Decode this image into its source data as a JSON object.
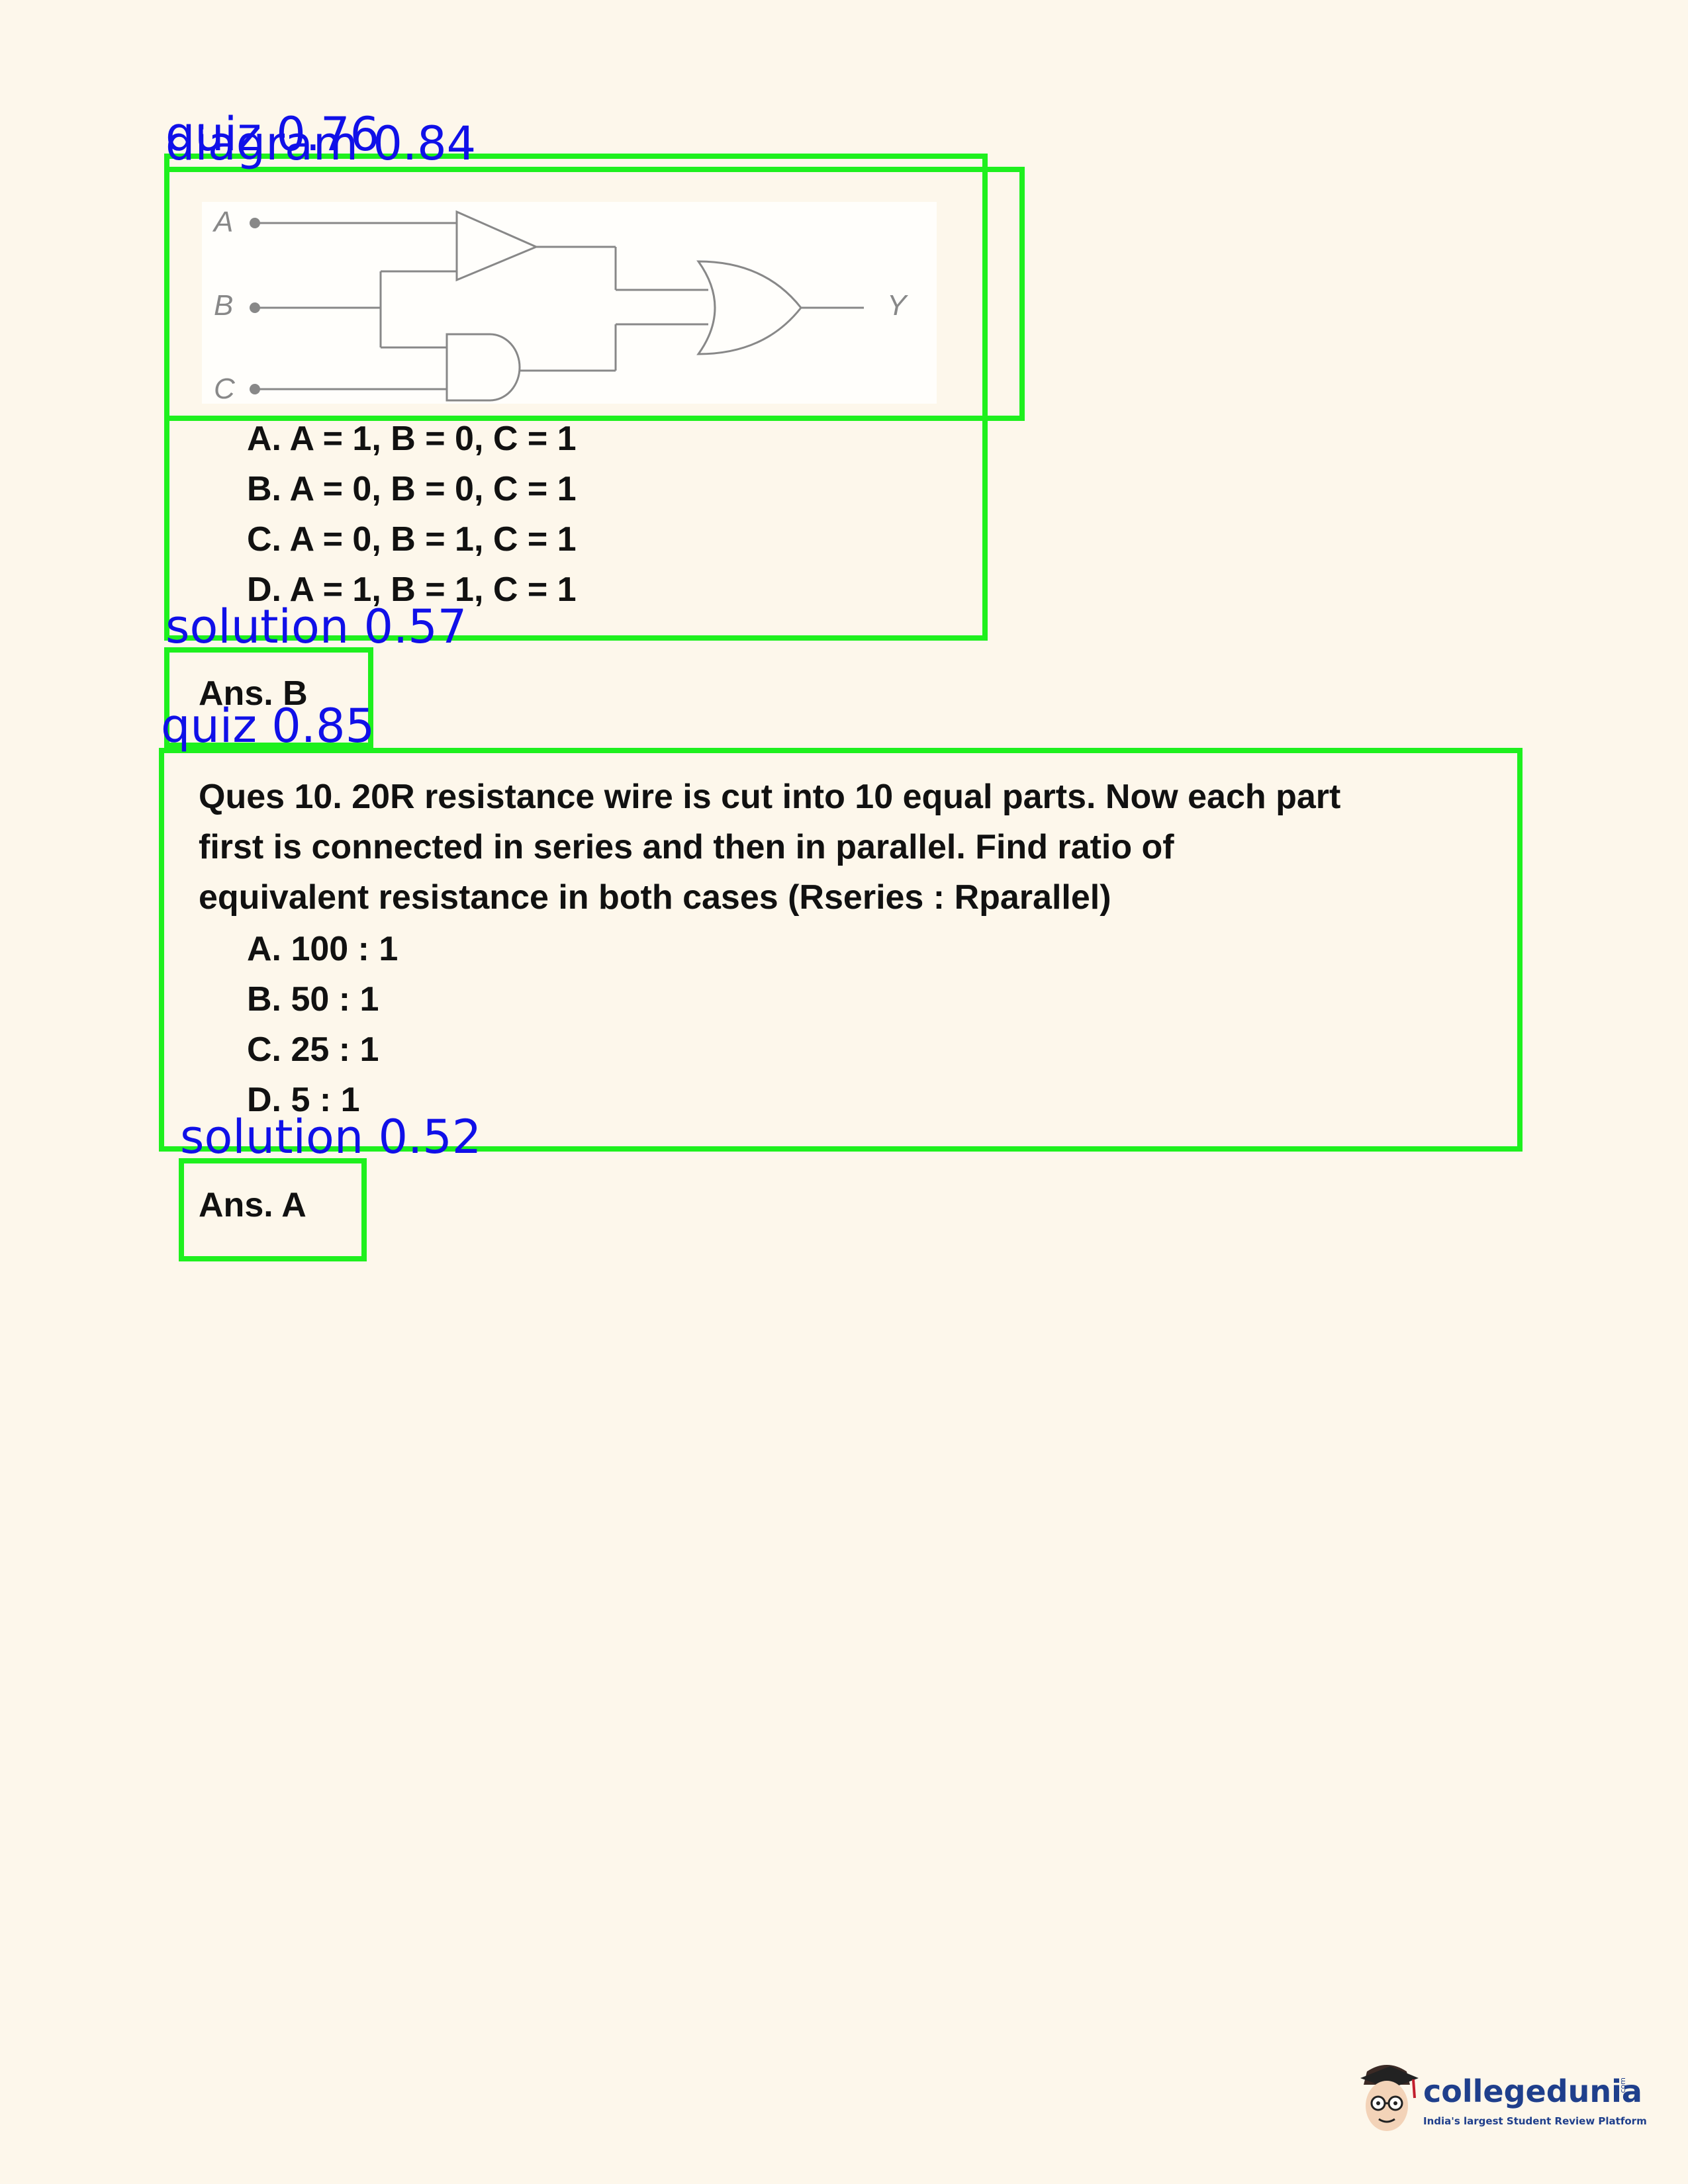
{
  "question9": {
    "diagram_labels": {
      "a": "A",
      "b": "B",
      "c": "C",
      "y": "Y"
    },
    "options": [
      "A. A = 1, B = 0, C = 1",
      "B. A = 0, B = 0, C = 1",
      "C. A = 0, B = 1, C = 1",
      "D. A = 1, B = 1, C = 1"
    ],
    "answer": "Ans. B"
  },
  "question10": {
    "lines": [
      "Ques 10. 20R resistance wire is cut into 10 equal parts. Now each part",
      "first is connected in series and then in parallel. Find ratio of",
      "equivalent resistance in both cases (Rseries : Rparallel)"
    ],
    "options": [
      "A. 100 : 1",
      "B. 50 : 1",
      "C. 25 : 1",
      "D. 5 : 1"
    ],
    "answer": "Ans. A"
  },
  "detections": [
    {
      "label": "quiz 0.76"
    },
    {
      "label": "diagram 0.84"
    },
    {
      "label": "solution 0.57"
    },
    {
      "label": "quiz 0.85"
    },
    {
      "label": "solution 0.52"
    }
  ],
  "logo": {
    "brand": "collegedunia",
    "tld": ".com",
    "tagline": "India's largest Student Review Platform"
  },
  "colors": {
    "page_background": "#fdf7eb",
    "detection_box": "#1ef01e",
    "detection_label": "#1010e8",
    "brand": "#1f3f8c"
  }
}
